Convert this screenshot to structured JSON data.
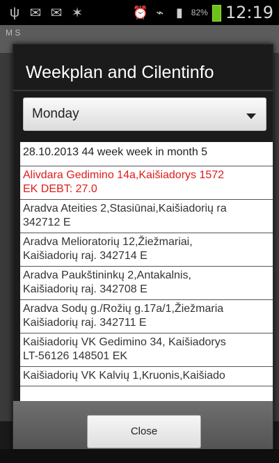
{
  "status_bar": {
    "left_icons": [
      "usb-icon",
      "mail-icon",
      "mail-icon",
      "signal-icon"
    ],
    "right_icons": [
      "alarm-icon",
      "wifi-icon",
      "mobile-signal-icon",
      "battery-icon"
    ],
    "battery_percent": "82%",
    "time": "12:19"
  },
  "background": {
    "top_text": "M S"
  },
  "dialog": {
    "title": "Weekplan and Cilentinfo",
    "day_spinner": {
      "selected": "Monday"
    },
    "list": {
      "header": "28.10.2013  44 week  week in month 5",
      "items": [
        {
          "line1": "Alivdara Gedimino 14a,Kaišiadorys 1572",
          "line2": "EK   DEBT: 27.0",
          "color": "#e01b1b"
        },
        {
          "line1": "Aradva Ateities 2,Stasiūnai,Kaišiadorių ra",
          "line2": "342712 E"
        },
        {
          "line1": "Aradva Melioratorių 12,Žiežmariai,",
          "line2": "Kaišiadorių raj. 342714 E"
        },
        {
          "line1": "Aradva Paukštininkų 2,Antakalnis,",
          "line2": "Kaišiadorių raj. 342708 E"
        },
        {
          "line1": "Aradva Sodų g./Rožių g.17a/1,Žiežmaria",
          "line2": "Kaišiadorių raj. 342711 E"
        },
        {
          "line1": "Kaišiadorių VK Gedimino 34, Kaišiadorys",
          "line2": "LT-56126 148501 EK"
        },
        {
          "line1": "Kaišiadorių VK Kalvių 1,Kruonis,Kaišiado",
          "line2": ""
        }
      ]
    },
    "close_label": "Close"
  }
}
